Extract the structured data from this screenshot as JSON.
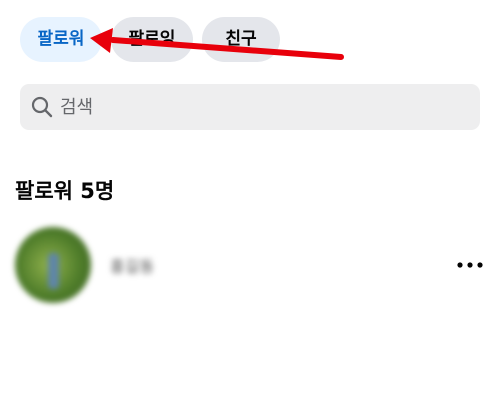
{
  "tabs": [
    {
      "label": "팔로워",
      "active": true
    },
    {
      "label": "팔로잉",
      "active": false
    },
    {
      "label": "친구",
      "active": false
    }
  ],
  "search": {
    "placeholder": "검색",
    "value": "",
    "icon": "search-icon"
  },
  "section": {
    "heading": "팔로워 5명"
  },
  "followers": [
    {
      "name": "홍길동",
      "avatar": "avatar",
      "more_icon": "more-horizontal-icon"
    }
  ],
  "annotation": {
    "arrow_color": "#e8000b"
  },
  "colors": {
    "active_tab_text": "#0866c6",
    "active_tab_bg": "#e7f3ff",
    "tab_bg": "#e4e6eb",
    "search_bg": "#eeeeef"
  }
}
